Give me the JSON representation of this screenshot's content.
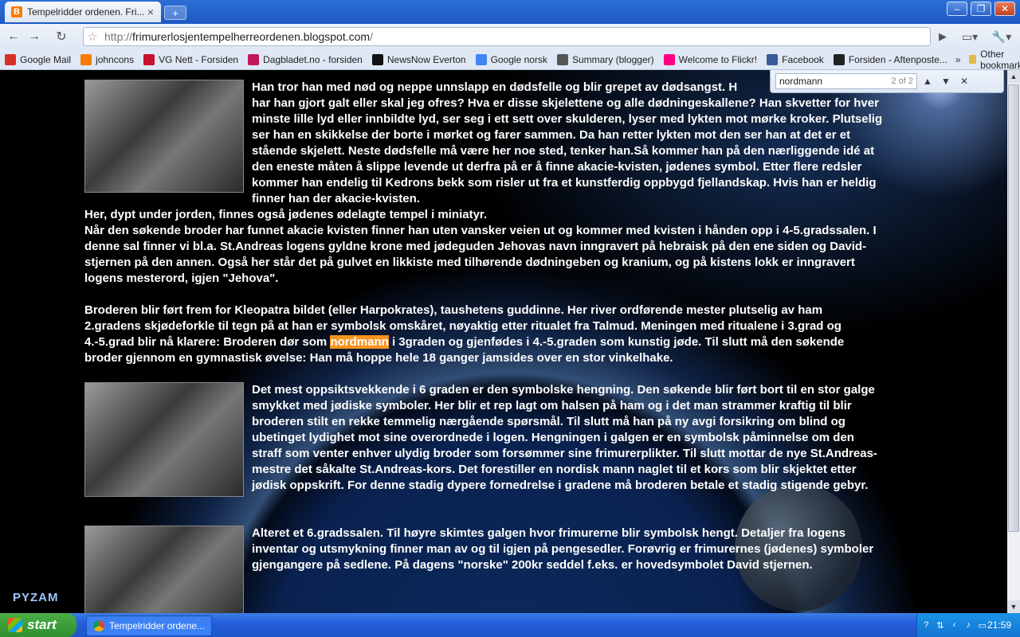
{
  "window": {
    "tab_title": "Tempelridder ordenen. Fri...",
    "tab_favicon": "blogger-icon",
    "new_tab": "+"
  },
  "toolbar": {
    "url_prefix": "http://",
    "url_domain": "frimurerlosjentempelherreordenen.blogspot.com",
    "url_suffix": "/"
  },
  "bookmarks": {
    "items": [
      {
        "label": "Google Mail",
        "icon": "gmail-icon",
        "color": "#d93025"
      },
      {
        "label": "johncons",
        "icon": "blogger-icon",
        "color": "#f57c00"
      },
      {
        "label": "VG Nett - Forsiden",
        "icon": "vg-icon",
        "color": "#c8102e"
      },
      {
        "label": "Dagbladet.no - forsiden",
        "icon": "dagbladet-icon",
        "color": "#c2185b"
      },
      {
        "label": "NewsNow Everton",
        "icon": "newsnow-icon",
        "color": "#111111"
      },
      {
        "label": "Google norsk",
        "icon": "google-icon",
        "color": "#4285f4"
      },
      {
        "label": "Summary (blogger)",
        "icon": "summary-icon",
        "color": "#555555"
      },
      {
        "label": "Welcome to Flickr!",
        "icon": "flickr-icon",
        "color": "#ff0084"
      },
      {
        "label": "Facebook",
        "icon": "facebook-icon",
        "color": "#3b5998"
      },
      {
        "label": "Forsiden - Aftenposte...",
        "icon": "aftenposten-icon",
        "color": "#222222"
      }
    ],
    "more": "»",
    "other": "Other bookmarks"
  },
  "find": {
    "query": "nordmann",
    "count": "2 of 2"
  },
  "content": {
    "p1": "Han tror han med nød og neppe unnslapp en dødsfelle og blir grepet av dødsangst. Hva har han gjort galt eller skal jeg ofres? Hva er disse skjelettene og alle dødningeskallene? Han skvetter for hver minste lille lyd eller innbildte lyd, ser seg i ett sett over skulderen, lyser med lykten mot mørke kroker. Plutselig ser han en skikkelse der borte i mørket og farer sammen. Da han retter lykten mot den ser han at det er et stående skjelett. Neste dødsfelle må være her noe sted, tenker han.Så kommer han på den nærliggende idé at den eneste måten å slippe levende ut derfra på er å finne akacie-kvisten, jødenes symbol. Etter flere redsler kommer han endelig til Kedrons bekk som risler ut fra et kunstferdig oppbygd fjellandskap. Hvis han er heldig finner han der akacie-kvisten.",
    "p1_line1": "Han tror han med nød og neppe unnslapp en dødsfelle og blir grepet av dødsangst. H",
    "p2": "Her, dypt under jorden, finnes også jødenes ødelagte tempel i miniatyr.",
    "p3": "Når den søkende broder har funnet akacie kvisten finner han uten vansker veien ut og kommer med kvisten i hånden opp i 4-5.gradssalen. I denne sal finner vi bl.a. St.Andreas logens gyldne krone med jødeguden Jehovas navn inngravert på hebraisk på den ene siden og David-stjernen på den annen. Også her står det på gulvet en likkiste med tilhørende dødningeben og kranium, og på kistens lokk er inngravert logens mesterord, igjen \"Jehova\".",
    "p4_before": "Broderen blir ført frem for Kleopatra bildet (eller Harpokrates), taushetens guddinne. Her river ordførende mester plutselig av ham 2.gradens skjødeforkle til tegn på at han er symbolsk omskåret, nøyaktig etter ritualet fra Talmud. Meningen med ritualene i 3.grad og 4.-5.grad blir nå klarere: Broderen dør som ",
    "p4_highlight": "nordmann",
    "p4_after": " i 3graden og gjenfødes i 4.-5.graden som kunstig jøde. Til slutt må den søkende broder gjennom en gymnastisk øvelse: Han må hoppe hele 18 ganger jamsides over en stor vinkelhake.",
    "p5": "Det mest oppsiktsvekkende i 6 graden er den symbolske hengning. Den søkende blir ført bort til en stor galge smykket med jødiske symboler. Her blir et rep lagt om halsen på ham og i det man strammer kraftig til blir broderen stilt en rekke temmelig nærgående spørsmål. Til slutt må han på ny avgi forsikring om blind og ubetinget lydighet mot sine overordnede i logen. Hengningen i galgen er en symbolsk påminnelse om den straff som venter enhver ulydig broder som forsømmer sine frimurerplikter. Til slutt mottar de nye St.Andreas-mestre det såkalte St.Andreas-kors. Det forestiller en nordisk mann naglet til et kors som blir skjektet etter jødisk oppskrift. For denne stadig dypere fornedrelse i gradene må broderen betale et stadig stigende gebyr.",
    "p6": "Alteret et 6.gradssalen. Til høyre skimtes galgen hvor frimurerne blir symbolsk hengt. Detaljer fra logens inventar og utsmykning finner man av og til igjen på pengesedler. Forøvrig er frimurernes (jødenes) symboler gjengangere på sedlene. På dagens \"norske\" 200kr seddel f.eks. er hovedsymbolet David stjernen."
  },
  "watermark": "PYZAM",
  "taskbar": {
    "start": "start",
    "task_label": "Tempelridder ordene...",
    "clock": "21:59"
  }
}
